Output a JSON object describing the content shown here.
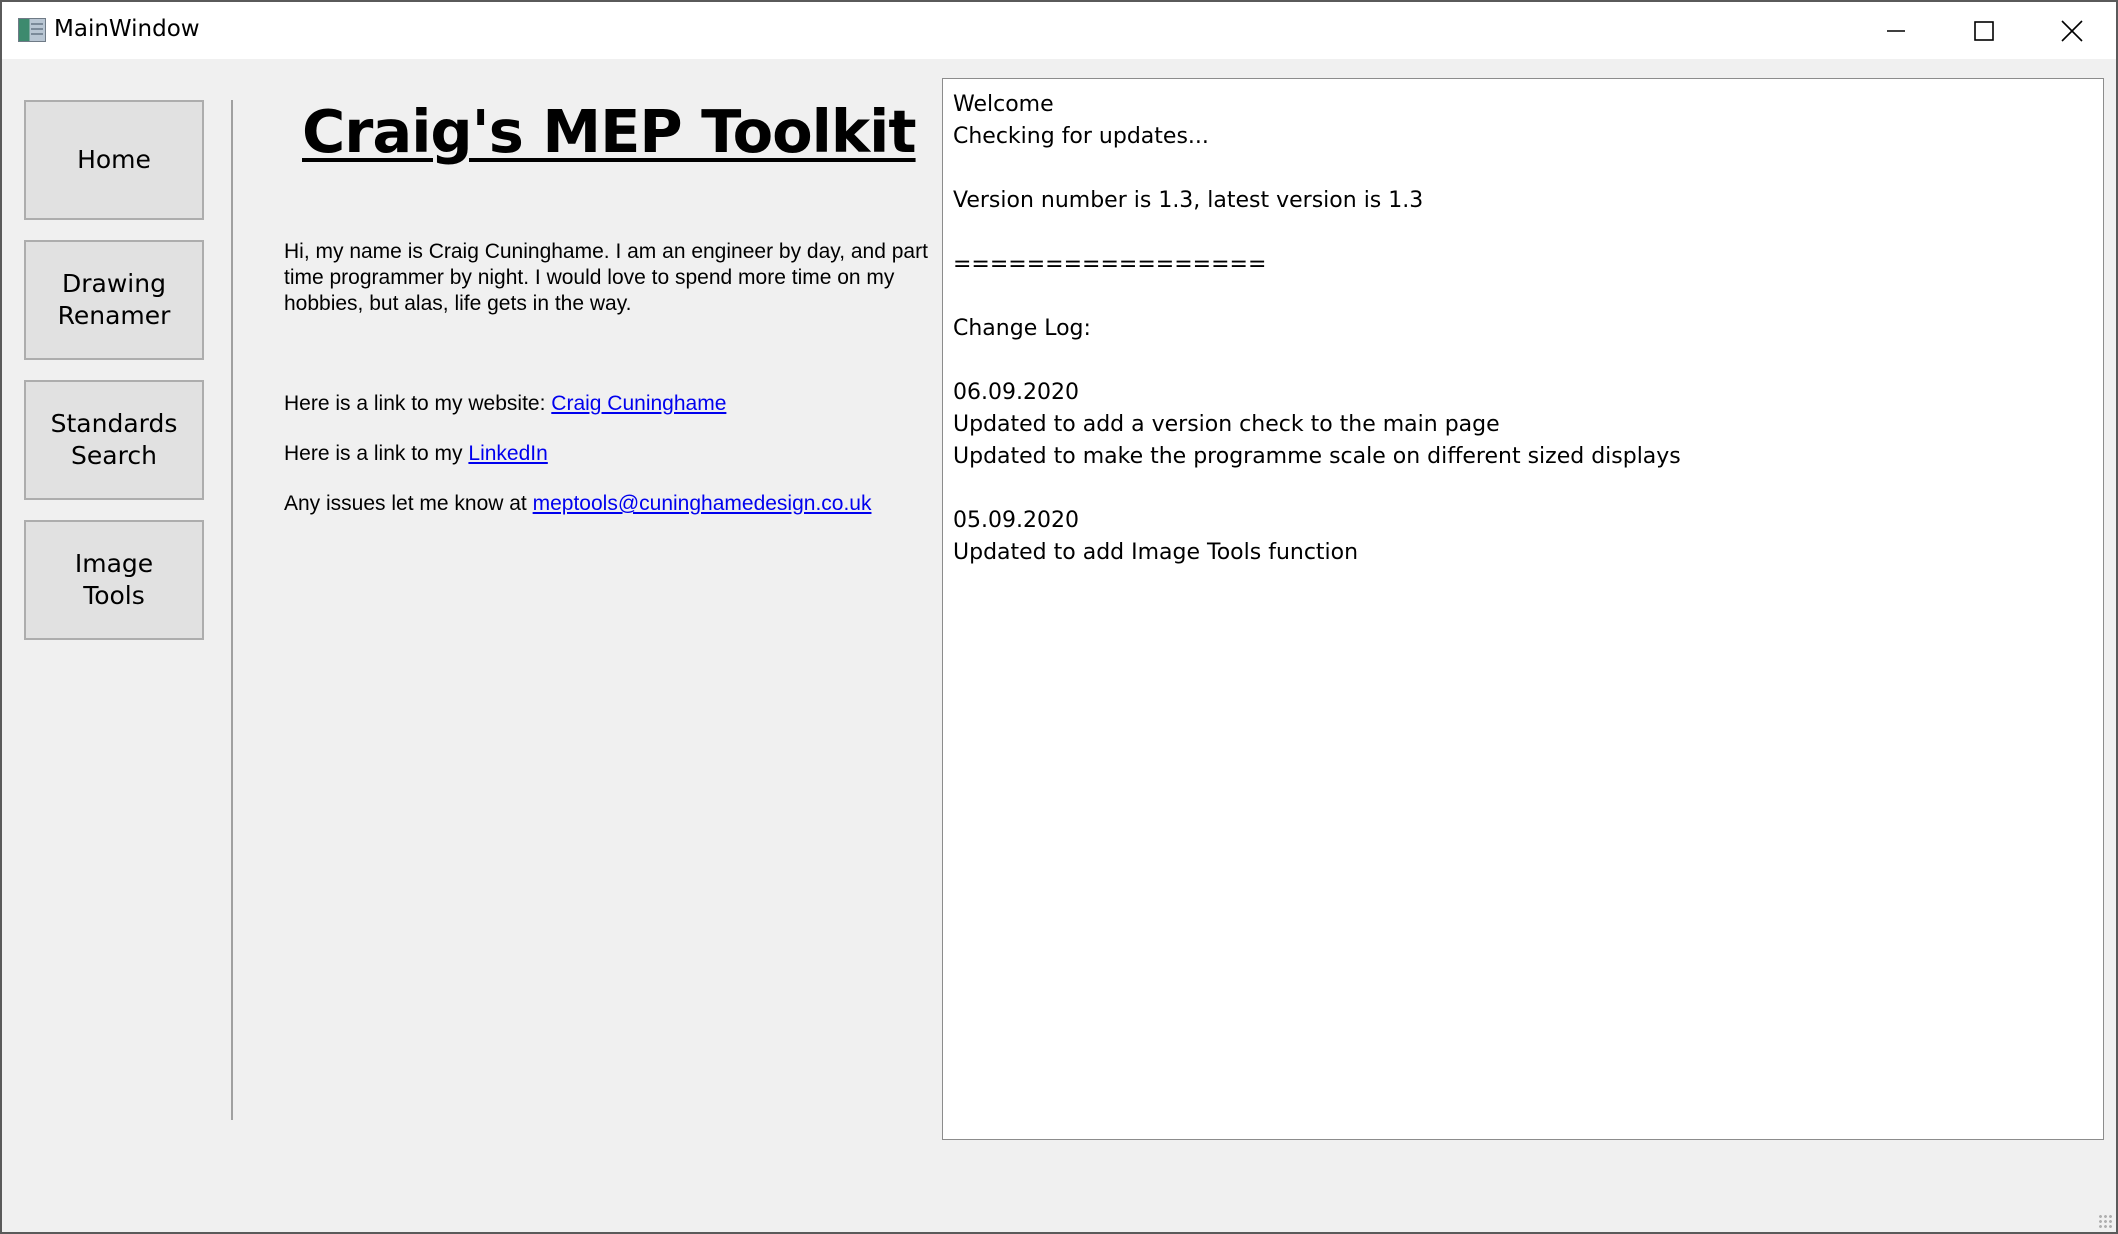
{
  "window": {
    "title": "MainWindow"
  },
  "nav": {
    "home_label": "Home",
    "renamer_label": "Drawing\nRenamer",
    "standards_label": "Standards\nSearch",
    "image_label": "Image\nTools"
  },
  "home": {
    "title": "Craig's MEP Toolkit",
    "intro": "Hi, my name is Craig Cuninghame. I am an engineer by day, and part time programmer by night. I would love to spend more time on my hobbies, but alas, life gets in the way.",
    "website_prefix": "Here is a link to my website:",
    "website_link": "Craig Cuninghame",
    "linkedin_prefix": "Here is a link to my",
    "linkedin_link": "LinkedIn",
    "email_prefix": "Any issues let me know at",
    "email_link": "meptools@cuninghamedesign.co.uk"
  },
  "log": {
    "lines": [
      "Welcome",
      "Checking for updates...",
      "",
      "Version number is 1.3, latest version is 1.3",
      "",
      "=================",
      "",
      "Change Log:",
      "",
      "06.09.2020",
      "Updated to add a version check to the main page",
      "Updated to make the programme scale on different sized displays",
      "",
      "05.09.2020",
      "Updated to add Image Tools function"
    ]
  }
}
